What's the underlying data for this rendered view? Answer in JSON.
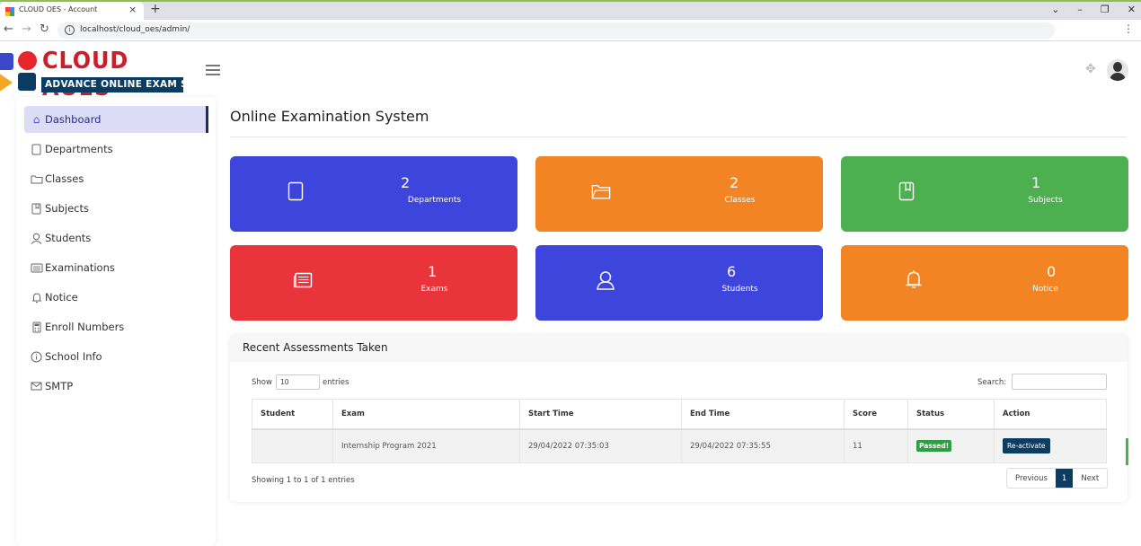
{
  "browser": {
    "tab_title": "CLOUD OES - Account",
    "tab_close": "×",
    "new_tab": "+",
    "url": "localhost/cloud_oes/admin/",
    "favicon_colors": [
      "#ea4335",
      "#4285f4",
      "#fbbc05",
      "#34a853"
    ]
  },
  "header": {
    "logo_title": "CLOUD AOES",
    "logo_subtitle": "ADVANCE ONLINE EXAM SYSTEM",
    "brand_colors": {
      "blue": "#3d47c9",
      "red": "#e8272d",
      "yellow": "#f5a623",
      "navy": "#0b3d63",
      "title_red": "#c8202a"
    }
  },
  "sidebar": {
    "items": [
      {
        "label": "Dashboard",
        "icon": "home-icon",
        "active": true
      },
      {
        "label": "Departments",
        "icon": "document-icon"
      },
      {
        "label": "Classes",
        "icon": "folder-icon"
      },
      {
        "label": "Subjects",
        "icon": "book-icon"
      },
      {
        "label": "Students",
        "icon": "user-icon"
      },
      {
        "label": "Examinations",
        "icon": "newspaper-icon"
      },
      {
        "label": "Notice",
        "icon": "bell-icon"
      },
      {
        "label": "Enroll Numbers",
        "icon": "calculator-icon"
      },
      {
        "label": "School Info",
        "icon": "info-icon"
      },
      {
        "label": "SMTP",
        "icon": "envelope-icon"
      }
    ]
  },
  "main": {
    "page_title": "Online Examination System",
    "cards": [
      {
        "value": "2",
        "label": "Departments",
        "color": "#3d45dc",
        "icon": "document-icon"
      },
      {
        "value": "2",
        "label": "Classes",
        "color": "#f28423",
        "icon": "folder-icon"
      },
      {
        "value": "1",
        "label": "Subjects",
        "color": "#4caf50",
        "icon": "book-icon"
      },
      {
        "value": "1",
        "label": "Exams",
        "color": "#e8343a",
        "icon": "newspaper-icon"
      },
      {
        "value": "6",
        "label": "Students",
        "color": "#3d45dc",
        "icon": "user-icon"
      },
      {
        "value": "0",
        "label": "Notice",
        "color": "#f28423",
        "icon": "bell-icon"
      }
    ],
    "assessments": {
      "title": "Recent Assessments Taken",
      "show_label": "Show",
      "page_size": "10",
      "entries_label": "entries",
      "search_label": "Search:",
      "columns": [
        "Student",
        "Exam",
        "Start Time",
        "End Time",
        "Score",
        "Status",
        "Action"
      ],
      "rows": [
        {
          "student": "",
          "exam": "Internship Program 2021",
          "start_time": "29/04/2022 07:35:03",
          "end_time": "29/04/2022 07:35:55",
          "score": "11",
          "status": "Passed!",
          "action": "Re-activate"
        }
      ],
      "showing_text": "Showing 1 to 1 of 1 entries",
      "pager": {
        "previous": "Previous",
        "current": "1",
        "next": "Next"
      }
    }
  }
}
